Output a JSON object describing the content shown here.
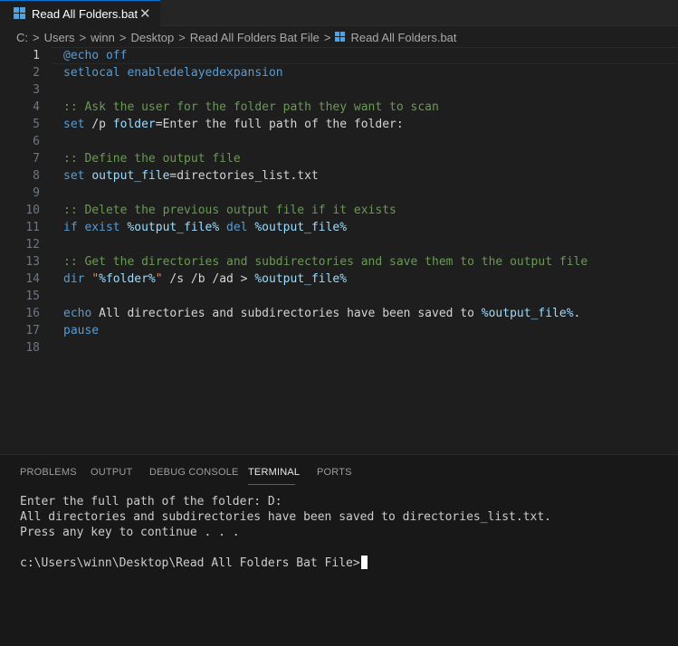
{
  "tab": {
    "label": "Read All Folders.bat",
    "close": "✕"
  },
  "breadcrumb": {
    "items": [
      "C:",
      "Users",
      "winn",
      "Desktop",
      "Read All Folders Bat File",
      "Read All Folders.bat"
    ],
    "separator": ">"
  },
  "editor": {
    "line_numbers": [
      "1",
      "2",
      "3",
      "4",
      "5",
      "6",
      "7",
      "8",
      "9",
      "10",
      "11",
      "12",
      "13",
      "14",
      "15",
      "16",
      "17",
      "18"
    ],
    "lines": [
      {
        "parts": [
          [
            "kw",
            "@echo off"
          ]
        ]
      },
      {
        "parts": [
          [
            "kw",
            "setlocal enabledelayedexpansion"
          ]
        ]
      },
      {
        "parts": []
      },
      {
        "parts": [
          [
            "cm",
            ":: Ask the user for the folder path they want to scan"
          ]
        ]
      },
      {
        "parts": [
          [
            "kw",
            "set"
          ],
          [
            "tx",
            " /p "
          ],
          [
            "var",
            "folder"
          ],
          [
            "tx",
            "=Enter the full path of the folder:"
          ]
        ]
      },
      {
        "parts": []
      },
      {
        "parts": [
          [
            "cm",
            ":: Define the output file"
          ]
        ]
      },
      {
        "parts": [
          [
            "kw",
            "set"
          ],
          [
            "tx",
            " "
          ],
          [
            "var",
            "output_file"
          ],
          [
            "tx",
            "=directories_list.txt"
          ]
        ]
      },
      {
        "parts": []
      },
      {
        "parts": [
          [
            "cm",
            ":: Delete the previous output file if it exists"
          ]
        ]
      },
      {
        "parts": [
          [
            "kw",
            "if exist"
          ],
          [
            "tx",
            " "
          ],
          [
            "var",
            "%output_file%"
          ],
          [
            "tx",
            " "
          ],
          [
            "kw",
            "del"
          ],
          [
            "tx",
            " "
          ],
          [
            "var",
            "%output_file%"
          ]
        ]
      },
      {
        "parts": []
      },
      {
        "parts": [
          [
            "cm",
            ":: Get the directories and subdirectories and save them to the output file"
          ]
        ]
      },
      {
        "parts": [
          [
            "kw",
            "dir"
          ],
          [
            "tx",
            " "
          ],
          [
            "str",
            "\""
          ],
          [
            "var",
            "%folder%"
          ],
          [
            "str",
            "\""
          ],
          [
            "tx",
            " /s /b /ad > "
          ],
          [
            "var",
            "%output_file%"
          ]
        ]
      },
      {
        "parts": []
      },
      {
        "parts": [
          [
            "kw",
            "echo"
          ],
          [
            "tx",
            " All directories and subdirectories have been saved to "
          ],
          [
            "var",
            "%output_file%"
          ],
          [
            "tx",
            "."
          ]
        ]
      },
      {
        "parts": [
          [
            "kw",
            "pause"
          ]
        ]
      },
      {
        "parts": []
      }
    ]
  },
  "panel": {
    "tabs": [
      "PROBLEMS",
      "OUTPUT",
      "DEBUG CONSOLE",
      "TERMINAL",
      "PORTS"
    ],
    "active_tab": "TERMINAL",
    "terminal_lines": [
      "Enter the full path of the folder: D:",
      "All directories and subdirectories have been saved to directories_list.txt.",
      "Press any key to continue . . .",
      "",
      "c:\\Users\\winn\\Desktop\\Read All Folders Bat File>"
    ]
  },
  "colors": {
    "accent": "#0078d4",
    "keyword": "#569cd6",
    "comment": "#6a9955",
    "variable": "#9cdcfe",
    "string": "#ce9178"
  }
}
